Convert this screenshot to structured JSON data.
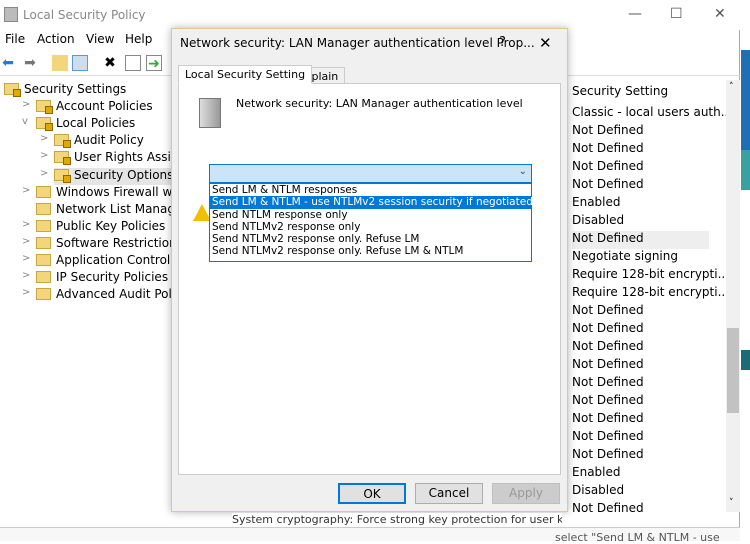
{
  "window": {
    "title": "Local Security Policy",
    "min": "—",
    "max": "☐",
    "close": "✕"
  },
  "menu": [
    "File",
    "Action",
    "View",
    "Help"
  ],
  "toolbar": [
    "back-icon",
    "forward-icon",
    "up-folder-icon",
    "show-hide-tree-icon",
    "delete-icon",
    "properties-icon",
    "export-icon"
  ],
  "tree": [
    {
      "label": "Security Settings",
      "level": 0,
      "chev": ""
    },
    {
      "label": "Account Policies",
      "level": 1,
      "chev": ">"
    },
    {
      "label": "Local Policies",
      "level": 1,
      "chev": "v"
    },
    {
      "label": "Audit Policy",
      "level": 2,
      "chev": ">"
    },
    {
      "label": "User Rights Assignment",
      "level": 2,
      "chev": ">"
    },
    {
      "label": "Security Options",
      "level": 2,
      "chev": ">",
      "selected": true
    },
    {
      "label": "Windows Firewall with Advanced Security",
      "level": 1,
      "chev": ">"
    },
    {
      "label": "Network List Manager Policies",
      "level": 1,
      "chev": ""
    },
    {
      "label": "Public Key Policies",
      "level": 1,
      "chev": ">"
    },
    {
      "label": "Software Restriction Policies",
      "level": 1,
      "chev": ">"
    },
    {
      "label": "Application Control Policies",
      "level": 1,
      "chev": ">"
    },
    {
      "label": "IP Security Policies on Local Computer",
      "level": 1,
      "chev": ">"
    },
    {
      "label": "Advanced Audit Policy Configuration",
      "level": 1,
      "chev": ">"
    }
  ],
  "list": {
    "header": "Security Setting",
    "rows": [
      "Classic - local users auth...",
      "Not Defined",
      "Not Defined",
      "Not Defined",
      "Not Defined",
      "Enabled",
      "Disabled",
      "Not Defined",
      "Negotiate signing",
      "Require 128-bit encrypti...",
      "Require 128-bit encrypti...",
      "Not Defined",
      "Not Defined",
      "Not Defined",
      "Not Defined",
      "Not Defined",
      "Not Defined",
      "Not Defined",
      "Not Defined",
      "Not Defined",
      "Enabled",
      "Disabled",
      "Not Defined"
    ],
    "hidden_row": "System cryptography: Force strong key protection for user k"
  },
  "dialog": {
    "title": "Network security: LAN Manager authentication level Prop...",
    "help": "?",
    "close": "✕",
    "tabs": [
      "Local Security Setting",
      "Explain"
    ],
    "policy_name": "Network security: LAN Manager authentication level",
    "combo_value": "",
    "options": [
      "Send LM & NTLM responses",
      "Send LM & NTLM - use NTLMv2 session security if negotiated",
      "Send NTLM response only",
      "Send NTLMv2 response only",
      "Send NTLMv2 response only. Refuse LM",
      "Send NTLMv2 response only. Refuse LM & NTLM"
    ],
    "highlighted_index": 1,
    "ok": "OK",
    "cancel": "Cancel",
    "apply": "Apply"
  },
  "background_text": "select \"Send LM & NTLM - use"
}
